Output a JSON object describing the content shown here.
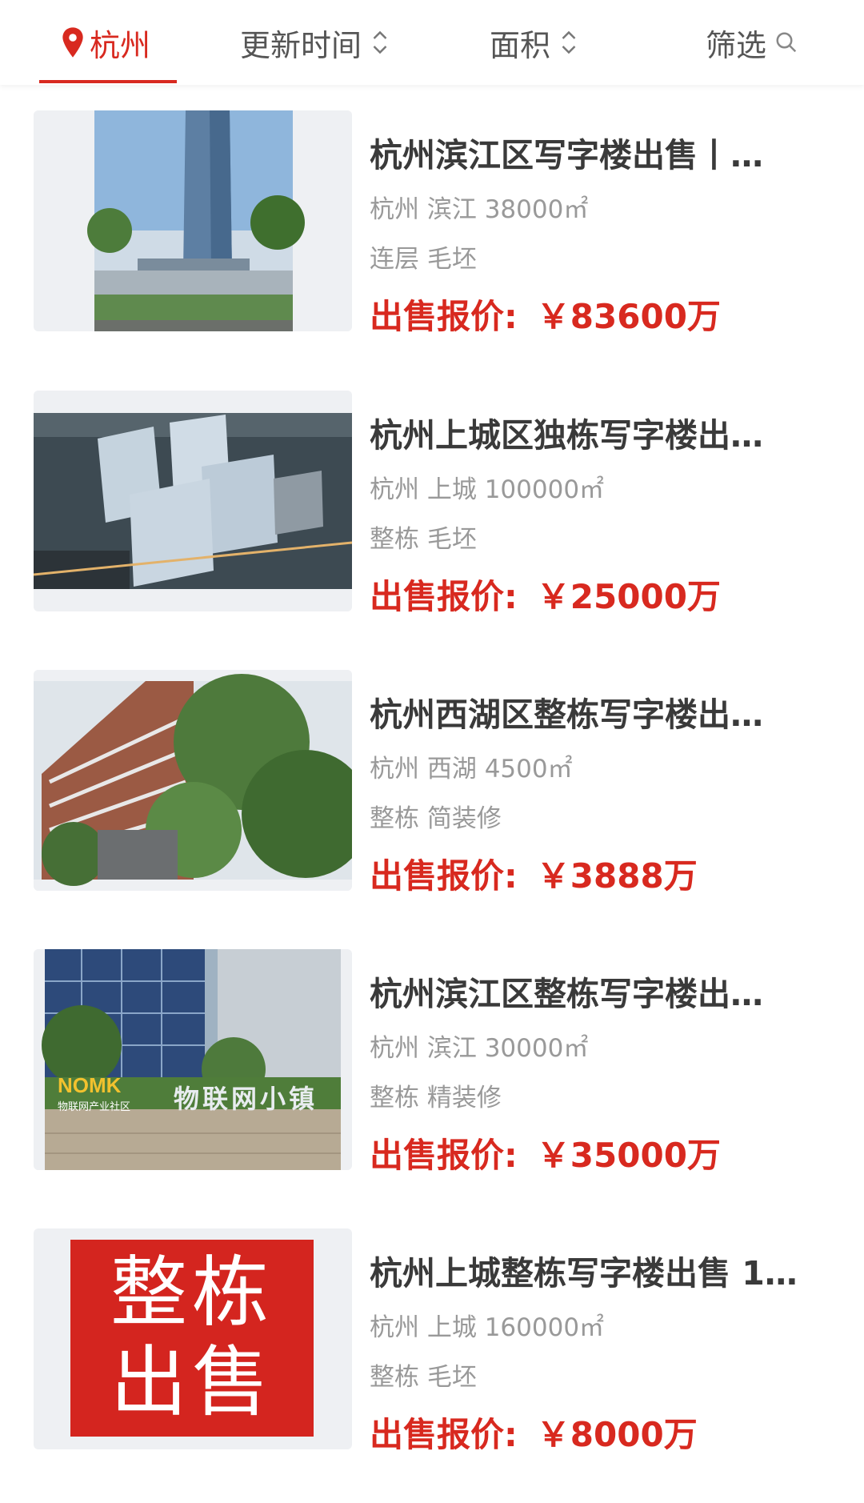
{
  "filter_bar": {
    "city": "杭州",
    "updated_label": "更新时间",
    "area_label": "面积",
    "filter_label": "筛选"
  },
  "colors": {
    "accent": "#d8291f",
    "title_text": "#3a3a3a",
    "meta_text": "#999999"
  },
  "listings": [
    {
      "title": "杭州滨江区写字楼出售丨…",
      "location": "杭州 滨江 38000㎡",
      "tags": "连层 毛坯",
      "price_label": "出售报价:",
      "price_value": "￥83600万",
      "image": "office-tower-photo"
    },
    {
      "title": "杭州上城区独栋写字楼出…",
      "location": "杭州 上城 100000㎡",
      "tags": "整栋 毛坯",
      "price_label": "出售报价:",
      "price_value": "￥25000万",
      "image": "campus-aerial-rendering"
    },
    {
      "title": "杭州西湖区整栋写字楼出…",
      "location": "杭州 西湖 4500㎡",
      "tags": "整栋 简装修",
      "price_label": "出售报价:",
      "price_value": "￥3888万",
      "image": "brick-building-photo"
    },
    {
      "title": "杭州滨江区整栋写字楼出…",
      "location": "杭州 滨江 30000㎡",
      "tags": "整栋 精装修",
      "price_label": "出售报价:",
      "price_value": "￥35000万",
      "image": "iot-town-entrance-photo",
      "sign_logo": "NOMK",
      "sign_sub": "物联网产业社区",
      "sign_text": "物联网小镇"
    },
    {
      "title": "杭州上城整栋写字楼出售 1…",
      "location": "杭州 上城 160000㎡",
      "tags": "整栋 毛坯",
      "price_label": "出售报价:",
      "price_value": "￥8000万",
      "image": "whole-building-for-sale-sign",
      "sign_line1": "整栋",
      "sign_line2": "出售"
    }
  ]
}
